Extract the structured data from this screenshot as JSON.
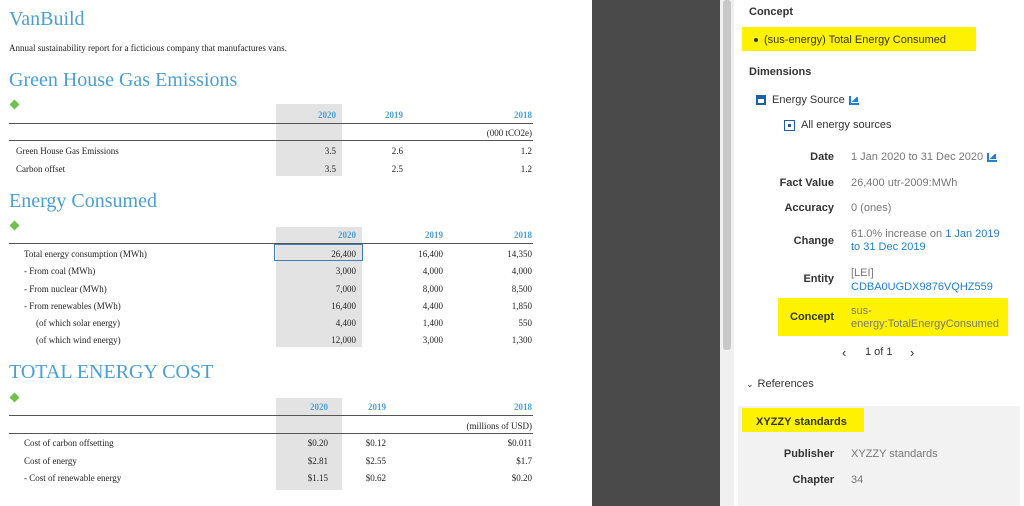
{
  "document": {
    "company": "VanBuild",
    "description": "Annual sustainability report for a ficticious company that manufactures vans.",
    "sections": [
      {
        "title": "Green House Gas Emissions",
        "years": [
          "2020",
          "2019",
          "2018"
        ],
        "unit": "(000 tCO2e)",
        "rows": [
          {
            "label": "Green House Gas Emissions",
            "values": [
              "3.5",
              "2.6",
              "1.2"
            ]
          },
          {
            "label": "Carbon offset",
            "values": [
              "3.5",
              "2.5",
              "1.2"
            ]
          }
        ]
      },
      {
        "title": "Energy Consumed",
        "years": [
          "2020",
          "2019",
          "2018"
        ],
        "rows": [
          {
            "label": "Total energy consumption (MWh)",
            "values": [
              "26,400",
              "16,400",
              "14,350"
            ]
          },
          {
            "label": "- From coal (MWh)",
            "values": [
              "3,000",
              "4,000",
              "4,000"
            ]
          },
          {
            "label": "- From nuclear (MWh)",
            "values": [
              "7,000",
              "8,000",
              "8,500"
            ]
          },
          {
            "label": "- From renewables (MWh)",
            "values": [
              "16,400",
              "4,400",
              "1,850"
            ]
          },
          {
            "label": "(of which solar energy)",
            "values": [
              "4,400",
              "1,400",
              "550"
            ]
          },
          {
            "label": "(of which wind energy)",
            "values": [
              "12,000",
              "3,000",
              "1,300"
            ]
          }
        ]
      },
      {
        "title": "TOTAL ENERGY COST",
        "years": [
          "2020",
          "2019",
          "2018"
        ],
        "unit": "(millions of USD)",
        "rows": [
          {
            "label": "Cost of carbon offsetting",
            "values": [
              "$0.20",
              "$0.12",
              "$0.011"
            ]
          },
          {
            "label": "Cost of energy",
            "values": [
              "$2.81",
              "$2.55",
              "$1.7"
            ]
          },
          {
            "label": "- Cost of renewable energy",
            "values": [
              "$1.15",
              "$0.62",
              "$0.20"
            ]
          }
        ]
      }
    ]
  },
  "panel": {
    "concept_heading": "Concept",
    "concept_item": "(sus-energy) Total Energy Consumed",
    "dimensions_heading": "Dimensions",
    "dimension_name": "Energy Source",
    "dimension_member": "All energy sources",
    "facts": {
      "date_key": "Date",
      "date_val": "1 Jan 2020 to 31 Dec 2020",
      "fact_value_key": "Fact Value",
      "fact_value_val": "26,400 utr-2009:MWh",
      "accuracy_key": "Accuracy",
      "accuracy_val": "0 (ones)",
      "change_key": "Change",
      "change_prefix": "61.0% increase on",
      "change_link_1": "1 Jan 2019",
      "change_link_2": "to 31 Dec 2019",
      "entity_key": "Entity",
      "entity_scheme": "[LEI]",
      "entity_id": "CDBA0UGDX9876VQHZ559",
      "concept_key": "Concept",
      "concept_line1": "sus-",
      "concept_line2": "energy:TotalEnergyConsumed"
    },
    "pager": {
      "prev": "‹",
      "label": "1 of 1",
      "next": "›"
    },
    "references_label": "References",
    "reference": {
      "title": "XYZZY standards",
      "publisher_key": "Publisher",
      "publisher_val": "XYZZY standards",
      "chapter_key": "Chapter",
      "chapter_val": "34"
    }
  },
  "colors": {
    "heading_blue": "#4a9fd6",
    "highlight_yellow": "#fff200",
    "marker_green": "#6cc24a",
    "dark_gutter": "#4a4a4a",
    "link_blue": "#1f7fd0"
  }
}
